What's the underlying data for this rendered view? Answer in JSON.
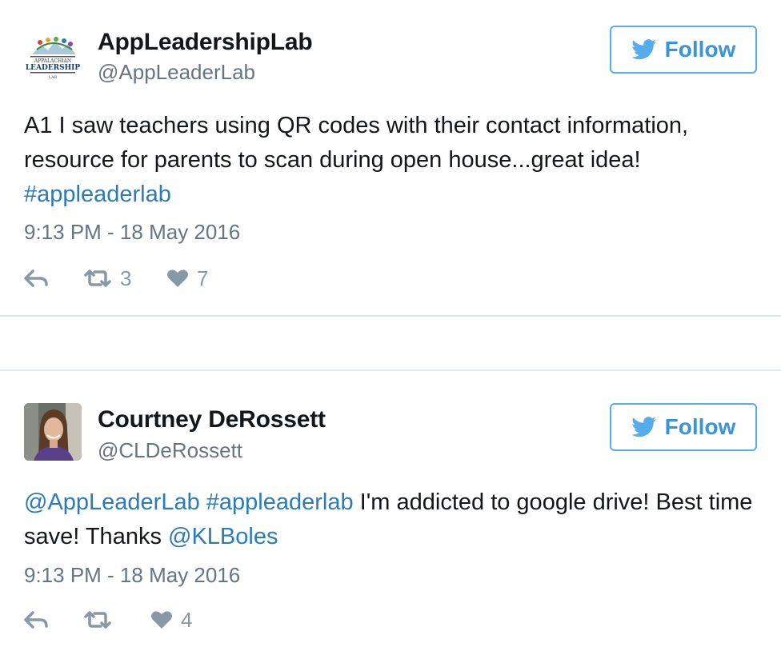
{
  "tweets": [
    {
      "author_name": "AppLeadershipLab",
      "handle": "@AppLeaderLab",
      "follow_label": "Follow",
      "avatar_logo_text": "LEADERSHIP",
      "text_segments": [
        {
          "text": "A1 I saw teachers using QR codes with their contact information, resource for parents to scan during open house...great idea! ",
          "type": "plain"
        },
        {
          "text": "#appleaderlab",
          "type": "hashtag"
        }
      ],
      "timestamp": "9:13 PM - 18 May 2016",
      "retweet_count": "3",
      "like_count": "7"
    },
    {
      "author_name": "Courtney DeRossett",
      "handle": "@CLDeRossett",
      "follow_label": "Follow",
      "text_segments": [
        {
          "text": "@AppLeaderLab",
          "type": "mention"
        },
        {
          "text": " ",
          "type": "plain"
        },
        {
          "text": "#appleaderlab",
          "type": "hashtag"
        },
        {
          "text": " I'm addicted to google drive! Best time save! Thanks ",
          "type": "plain"
        },
        {
          "text": "@KLBoles",
          "type": "mention"
        }
      ],
      "timestamp": "9:13 PM - 18 May 2016",
      "retweet_count": "",
      "like_count": "4"
    }
  ],
  "colors": {
    "accent": "#55acee",
    "link": "#2b7bb9",
    "muted": "#66757f",
    "icon": "#8899a6",
    "divider": "#e1e8ed"
  },
  "icons": {
    "follow": "twitter-bird-icon",
    "reply": "reply-icon",
    "retweet": "retweet-icon",
    "like": "heart-icon"
  }
}
